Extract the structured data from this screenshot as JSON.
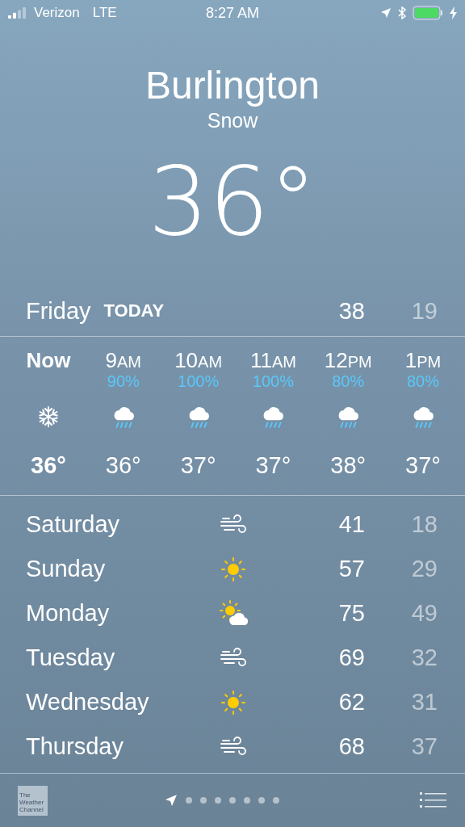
{
  "status_bar": {
    "carrier": "Verizon",
    "network": "LTE",
    "time": "8:27 AM",
    "charging": true
  },
  "header": {
    "city": "Burlington",
    "condition": "Snow",
    "temperature": "36°"
  },
  "today": {
    "day": "Friday",
    "label": "TODAY",
    "high": "38",
    "low": "19"
  },
  "hourly": [
    {
      "hour": "Now",
      "kind": "snow",
      "temp": "36°",
      "now": true
    },
    {
      "hour": "9",
      "period": "AM",
      "chance": "90%",
      "kind": "rain",
      "temp": "36°",
      "now": false
    },
    {
      "hour": "10",
      "period": "AM",
      "chance": "100%",
      "kind": "rain",
      "temp": "37°",
      "now": false
    },
    {
      "hour": "11",
      "period": "AM",
      "chance": "100%",
      "kind": "rain",
      "temp": "37°",
      "now": false
    },
    {
      "hour": "12",
      "period": "PM",
      "chance": "80%",
      "kind": "rain",
      "temp": "38°",
      "now": false
    },
    {
      "hour": "1",
      "period": "PM",
      "chance": "80%",
      "kind": "rain",
      "temp": "37°",
      "now": false
    }
  ],
  "daily": [
    {
      "day": "Saturday",
      "kind": "wind",
      "high": "41",
      "low": "18"
    },
    {
      "day": "Sunday",
      "kind": "sun",
      "high": "57",
      "low": "29"
    },
    {
      "day": "Monday",
      "kind": "partly_cloudy",
      "high": "75",
      "low": "49"
    },
    {
      "day": "Tuesday",
      "kind": "wind",
      "high": "69",
      "low": "32"
    },
    {
      "day": "Wednesday",
      "kind": "sun",
      "high": "62",
      "low": "31"
    },
    {
      "day": "Thursday",
      "kind": "wind",
      "high": "68",
      "low": "37"
    }
  ],
  "footer": {
    "logo_lines": [
      "The",
      "Weather",
      "Channel"
    ],
    "pages": [
      {
        "kind": "location",
        "selected": true
      },
      {
        "kind": "dot",
        "selected": false
      },
      {
        "kind": "dot",
        "selected": false
      },
      {
        "kind": "dot",
        "selected": false
      },
      {
        "kind": "dot",
        "selected": false
      },
      {
        "kind": "dot",
        "selected": false
      },
      {
        "kind": "dot",
        "selected": false
      },
      {
        "kind": "dot",
        "selected": false
      }
    ]
  }
}
